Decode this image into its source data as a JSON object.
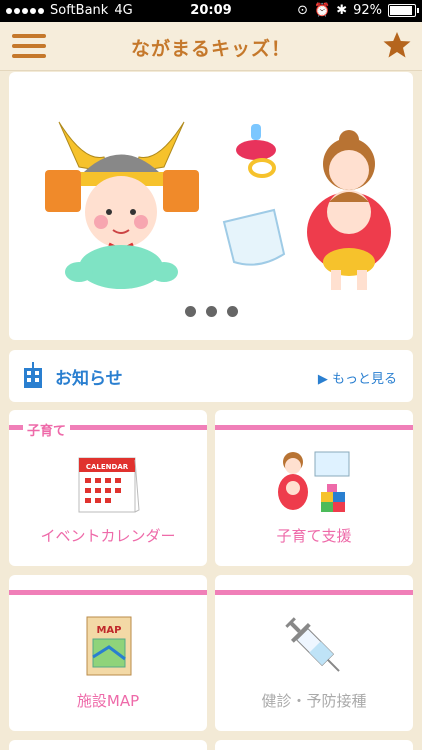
{
  "status_bar": {
    "carrier": "SoftBank",
    "network": "4G",
    "time": "20:09",
    "battery": "92%"
  },
  "navbar": {
    "title": "ながまるキッズ！"
  },
  "notice": {
    "label": "お知らせ",
    "more": "▶ もっと見る"
  },
  "section": {
    "label": "子育て"
  },
  "tiles": [
    {
      "label": "イベントカレンダー"
    },
    {
      "label": "子育て支援"
    },
    {
      "label": "施設MAP"
    },
    {
      "label": "健診・予防接種"
    }
  ],
  "icons": {
    "calendar_text": "CALENDAR",
    "map_text": "MAP"
  },
  "carousel": {
    "pages": 3
  },
  "colors": {
    "accent": "#c5782b",
    "pink": "#ee6aa9",
    "blue": "#2a7fd0"
  }
}
